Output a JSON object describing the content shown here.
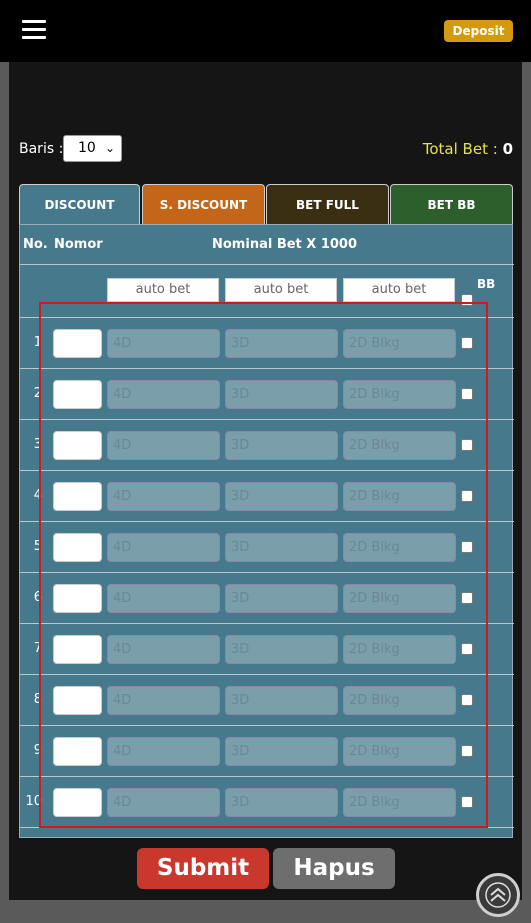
{
  "header": {
    "deposit_label": "Deposit"
  },
  "controls": {
    "baris_label": "Baris :",
    "baris_value": "10",
    "total_label": "Total Bet :",
    "total_value": "0"
  },
  "tabs": [
    {
      "label": "DISCOUNT",
      "bg": "#46798b"
    },
    {
      "label": "S. DISCOUNT",
      "bg": "#c4661a"
    },
    {
      "label": "BET FULL",
      "bg": "#3a2f12"
    },
    {
      "label": "BET BB",
      "bg": "#2d5f2d"
    }
  ],
  "table": {
    "col_no": "No.",
    "col_nomor": "Nomor",
    "col_nominal": "Nominal Bet X 1000",
    "col_bb": "BB",
    "auto_bet": [
      "auto bet",
      "auto bet",
      "auto bet"
    ],
    "placeholders": [
      "4D",
      "3D",
      "2D Blkg"
    ],
    "rows": [
      "1",
      "2",
      "3",
      "4",
      "5",
      "6",
      "7",
      "8",
      "9",
      "10"
    ]
  },
  "actions": {
    "submit_label": "Submit",
    "hapus_label": "Hapus"
  }
}
